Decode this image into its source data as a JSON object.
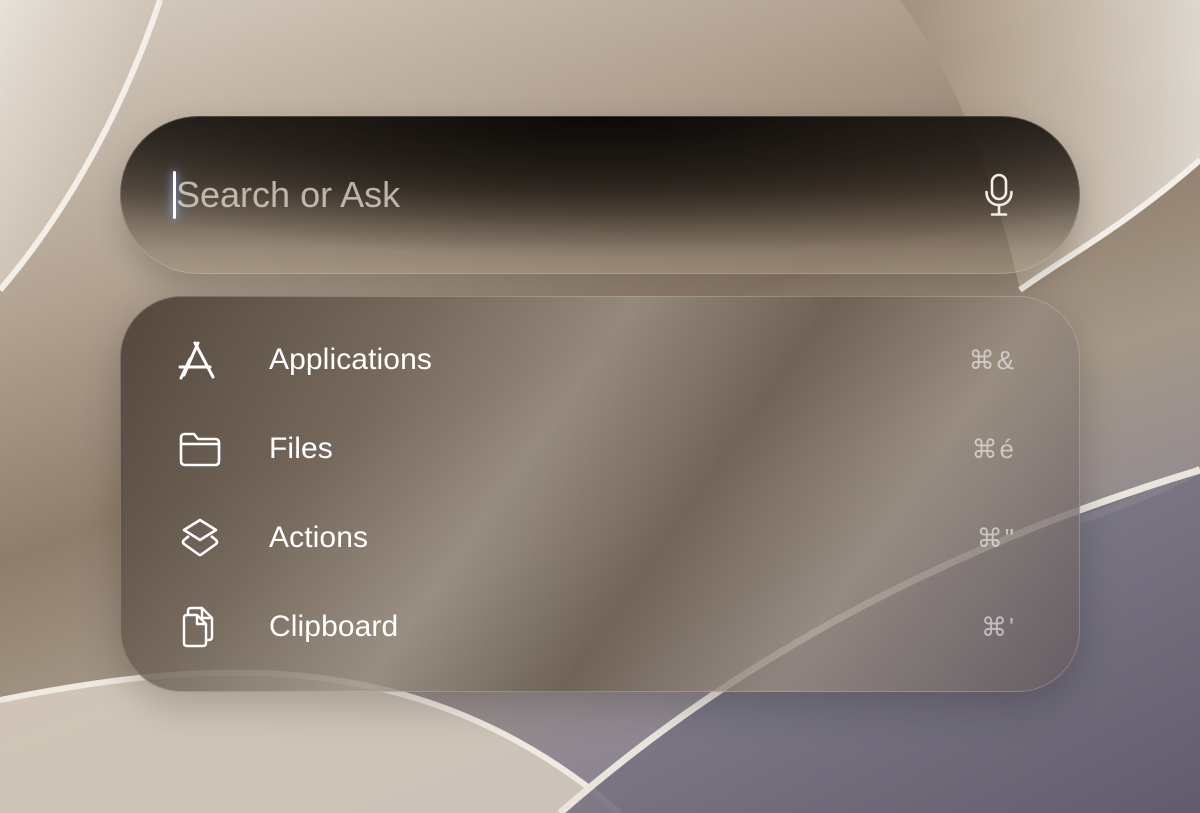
{
  "search": {
    "placeholder": "Search or Ask",
    "value": ""
  },
  "results": [
    {
      "label": "Applications",
      "shortcut": "⌘&",
      "icon": "app-store-icon"
    },
    {
      "label": "Files",
      "shortcut": "⌘é",
      "icon": "folder-icon"
    },
    {
      "label": "Actions",
      "shortcut": "⌘\"",
      "icon": "layers-icon"
    },
    {
      "label": "Clipboard",
      "shortcut": "⌘'",
      "icon": "clipboard-icon"
    }
  ],
  "colors": {
    "caret_glow": "#8fb6ff",
    "text_primary": "#ffffff",
    "text_placeholder": "#ebe4da"
  }
}
